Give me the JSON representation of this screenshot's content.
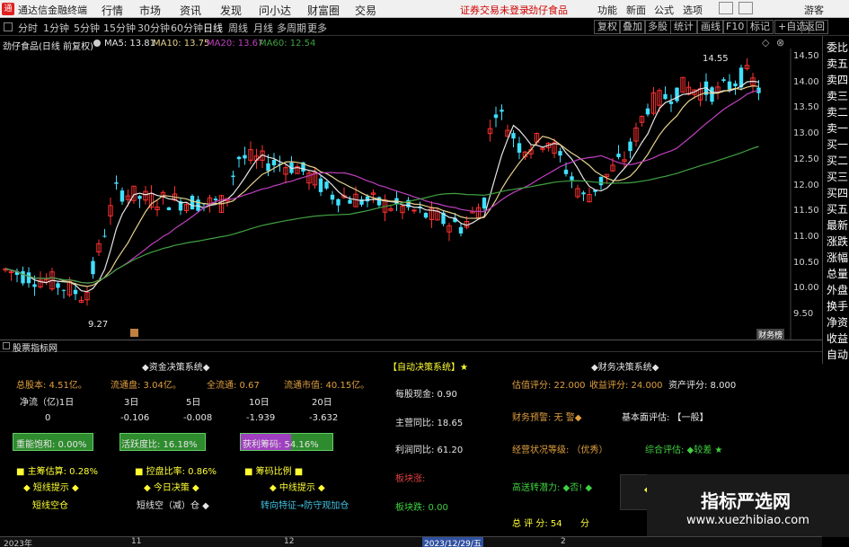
{
  "menubar": {
    "app_name": "通达信金融终端",
    "items": [
      "行情",
      "市场",
      "资讯",
      "发现",
      "问小达",
      "财富圈",
      "交易"
    ],
    "notice1": "证券交易未登录",
    "notice2": "劲仔食品",
    "right_items": [
      "功能",
      "新面",
      "公式",
      "选项",
      "游客"
    ]
  },
  "toolbar": {
    "periods": [
      "分时",
      "1分钟",
      "5分钟",
      "15分钟",
      "30分钟",
      "60分钟",
      "日线",
      "周线",
      "月线",
      "多周期",
      "更多"
    ],
    "active_period": "日线",
    "buttons": [
      "复权",
      "叠加",
      "多股",
      "统计",
      "画线",
      "F10",
      "标记",
      "+自选",
      "返回"
    ]
  },
  "chart": {
    "stock_title": "劲仔食品(日线 前复权)",
    "ma5_label": "MA5: 13.81",
    "ma10_label": "MA10: 13.75",
    "ma20_label": "MA20: 13.67",
    "ma60_label": "MA60: 12.54",
    "high_label": "14.55",
    "low_label": "9.27",
    "y_ticks": [
      "14.50",
      "14.00",
      "13.50",
      "13.00",
      "12.50",
      "12.00",
      "11.50",
      "11.00",
      "10.50",
      "10.00",
      "9.50"
    ],
    "tag": "财务榜",
    "colors": {
      "ma5": "#e6e6e6",
      "ma10": "#e6d28c",
      "ma20": "#c040c0",
      "ma60": "#40a040",
      "up": "#ff3030",
      "down": "#40e0ff"
    }
  },
  "rightside": [
    "委比",
    "卖五",
    "卖四",
    "卖三",
    "卖二",
    "卖一",
    "买一",
    "买二",
    "买三",
    "买四",
    "买五",
    "最新",
    "涨跌",
    "涨幅",
    "总量",
    "外盘",
    "换手",
    "净资",
    "收益",
    "自动"
  ],
  "panel": {
    "tab": "股票指标网",
    "fund_title": "◆资金决策系统◆",
    "total_shares": "总股本: 4.51亿。",
    "float_shares": "流通盘: 3.04亿。",
    "full_float": "全流通: 0.67",
    "float_mv": "流通市值: 40.15亿。",
    "netflow_label": "净流（亿)1日",
    "periods": [
      "3日",
      "5日",
      "10日",
      "20日"
    ],
    "netflow_values": [
      "0",
      "-0.106",
      "-0.008",
      "-1.939",
      "-3.632"
    ],
    "bar1": "重能饱和: 0.00%",
    "bar2": "活跃度比: 16.18%",
    "bar3": "获利筹码: 54.16%",
    "main_cost": "■ 主筹估算: 0.28%",
    "control": "■ 控盘比率: 0.86%",
    "chip": "■ 筹码比例 ■",
    "short_tip": "◆ 短线提示 ◆",
    "today_tip": "◆ 今日决策 ◆",
    "mid_tip": "◆ 中线提示 ◆",
    "short_val": "短线空仓",
    "today_val": "短线空（减）仓 ◆",
    "mid_val": "转向特征→防守观加仓",
    "auto_title": "【自动决策系统】★",
    "eps": "每股现金: 0.90",
    "rev_yoy": "主营同比: 18.65",
    "profit_yoy": "利润同比: 61.20",
    "rise": "板块涨:",
    "fall": "板块跌: 0.00",
    "fin_title": "◆财务决策系统◆",
    "valuation": "估值评分: 22.000",
    "income": "收益评分: 24.000",
    "asset": "资产评分: 8.000",
    "warning": "财务预警: 无 警◆",
    "fundamental": "基本面评估: 【一般】",
    "operation": "经营状况等级: （优秀）",
    "overall": "综合评估: ◆较差 ★",
    "growth": "高送转潜力: ◆否! ◆",
    "total_score": "总 评 分: 54",
    "score_unit": "分"
  },
  "datebar": {
    "labels": [
      "2023年",
      "11",
      "12",
      "2023/12/29/五",
      "2"
    ]
  },
  "watermark": {
    "line1": "指标严选网",
    "line2": "www.xuezhibiao.com"
  }
}
